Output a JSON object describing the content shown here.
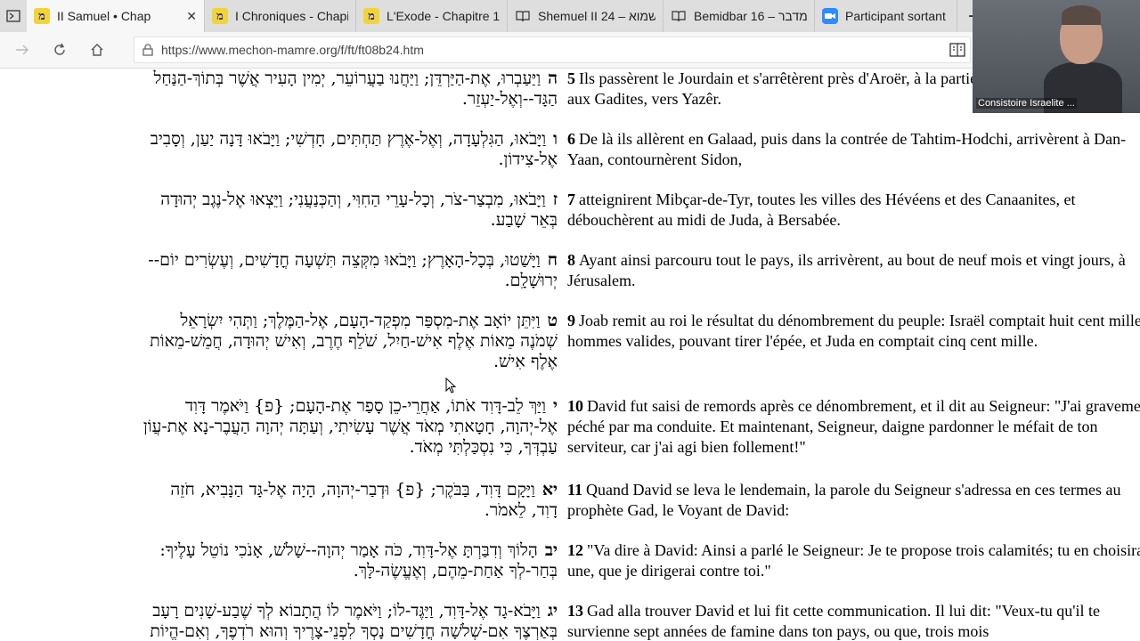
{
  "tabs": [
    {
      "title": "II Samuel • Chap",
      "icon": "mechon-mamre-favicon",
      "active": true
    },
    {
      "title": "I Chroniques - Chapi",
      "icon": "mechon-mamre-favicon"
    },
    {
      "title": "L'Exode - Chapitre 1",
      "icon": "mechon-mamre-favicon"
    },
    {
      "title": "Shemuel II 24 – שמוא",
      "icon": "book-favicon"
    },
    {
      "title": "Bemidbar 16 – במדבר",
      "icon": "book-favicon"
    },
    {
      "title": "Participant sortant de",
      "icon": "zoom-favicon"
    }
  ],
  "address": {
    "url": "https://www.mechon-mamre.org/f/ft/ft08b24.htm"
  },
  "webcam": {
    "label": "Consistoire Israelite ..."
  },
  "verses": [
    {
      "hnum": "ה",
      "heb": [
        "וַיַּעַבְרוּ, אֶת-הַיַּרְדֵּן; וַיַּחֲנוּ בַעֲרוֹעֵר, יְמִין הָעִיר אֲשֶׁר בְּתוֹךְ-הַנַּחַל",
        "הַגָּד--וְאֶל-יַעְזֵר."
      ],
      "num": "5",
      "fr": "Ils passèrent le Jourdain et s'arrêtèrent près d'Aroër, à la partie de la vallée appartenant aux Gadites, vers Yazêr."
    },
    {
      "hnum": "ו",
      "heb": [
        "וַיָּבֹאוּ, הַגִּלְעָדָה, וְאֶל-אֶרֶץ תַּחְתִּים, חָדְשִׁי; וַיָּבֹאוּ דָּנָה יַעַן, וְסָבִיב",
        "אֶל-צִידוֹן."
      ],
      "num": "6",
      "fr": "De là ils allèrent en Galaad, puis dans la contrée de Tahtim-Hodchi, arrivèrent à Dan-Yaan, contournèrent Sidon,"
    },
    {
      "hnum": "ז",
      "heb": [
        "וַיָּבֹאוּ, מִבְצַר-צֹר, וְכָל-עָרֵי הַחִוִּי, וְהַכְּנַעֲנִי; וַיֵּצְאוּ אֶל-נֶגֶב יְהוּדָה",
        "בְּאֵר שָׁבַע."
      ],
      "num": "7",
      "fr": "atteignirent Mibçar-de-Tyr, toutes les villes des Hévéens et des Canaanites, et débouchèrent au midi de Juda, à Bersabée."
    },
    {
      "hnum": "ח",
      "heb": [
        "וַיָּשַׁטוּ, בְּכָל-הָאָרֶץ; וַיָּבֹאוּ מִקְּצֵה תִּשְׁעָה חֳדָשִׁים, וְעֶשְׂרִים יוֹם--",
        "יְרוּשָׁלִָם."
      ],
      "num": "8",
      "fr": "Ayant ainsi parcouru tout le pays, ils arrivèrent, au bout de neuf mois et vingt jours, à Jérusalem."
    },
    {
      "hnum": "ט",
      "heb": [
        "וַיִּתֵּן יוֹאָב אֶת-מִסְפַּר מִפְקַד-הָעָם, אֶל-הַמֶּלֶךְ; וַתְּהִי יִשְׂרָאֵל",
        "שְׁמֹנֶה מֵאוֹת אֶלֶף אִישׁ-חַיִל, שֹׁלֵף חֶרֶב, וְאִישׁ יְהוּדָה, חֲמֵשׁ-מֵאוֹת",
        "אֶלֶף אִישׁ."
      ],
      "num": "9",
      "fr": "Joab remit au roi le résultat du dénombrement du peuple: Israël comptait huit cent mille hommes valides, pouvant tirer l'épée, et Juda en comptait cinq cent mille."
    },
    {
      "hnum": "י",
      "heb": [
        "וַיַּךְ לֵב-דָּוִד אֹתוֹ, אַחֲרֵי-כֵן סָפַר אֶת-הָעָם; {פ} וַיֹּאמֶר דָּוִד",
        "אֶל-יְהוָה, חָטָאתִי מְאֹד אֲשֶׁר עָשִׂיתִי, וְעַתָּה יְהוָה הַעֲבֶר-נָא אֶת-עֲוֹן",
        "עַבְדְּךָ, כִּי נִסְכַּלְתִּי מְאֹד."
      ],
      "num": "10",
      "fr": "David fut saisi de remords après ce dénombrement, et il dit au Seigneur: \"J'ai gravement péché par ma conduite. Et maintenant, Seigneur, daigne pardonner le méfait de ton serviteur, car j'ai agi bien follement!\""
    },
    {
      "hnum": "יא",
      "heb": [
        "וַיָּקָם דָּוִד, בַּבֹּקֶר; {פ} וּדְבַר-יְהוָה, הָיָה אֶל-גָּד הַנָּבִיא, חֹזֵה",
        "דָוִד, לֵאמֹר."
      ],
      "num": "11",
      "fr": "Quand David se leva le lendemain, la parole du Seigneur s'adressa en ces termes au prophète Gad, le Voyant de David:"
    },
    {
      "hnum": "יב",
      "heb": [
        "הָלוֹךְ וְדִבַּרְתָּ אֶל-דָּוִד, כֹּה אָמַר יְהוָה--שָׁלֹשׁ, אָנֹכִי נוֹטֵל עָלֶיךָ:",
        "בְּחַר-לְךָ אַחַת-מֵהֶם, וְאֶעֱשֶׂה-לָּךְ."
      ],
      "num": "12",
      "fr": "\"Va dire à David: Ainsi a parlé le Seigneur: Je te propose trois calamités; tu en choisiras une, que je dirigerai contre toi.\""
    },
    {
      "hnum": "יג",
      "heb": [
        "וַיָּבֹא-גָד אֶל-דָּוִד, וַיַּגֶּד-לוֹ; וַיֹּאמֶר לוֹ הֲתָבוֹא לְךָ שֶׁבַע-שָׁנִים רָעָב",
        "בְּאַרְצֶךָ אִם-שְׁלֹשָׁה חֳדָשִׁים נָסְךָ לִפְנֵי-צָרֶיךָ וְהוּא רֹדְפֶךָ, וְאִם-הֱיוֹת"
      ],
      "num": "13",
      "fr": "Gad alla trouver David et lui fit cette communication. Il lui dit: \"Veux-tu qu'il te survienne sept années de famine dans ton pays, ou que, trois mois"
    }
  ]
}
